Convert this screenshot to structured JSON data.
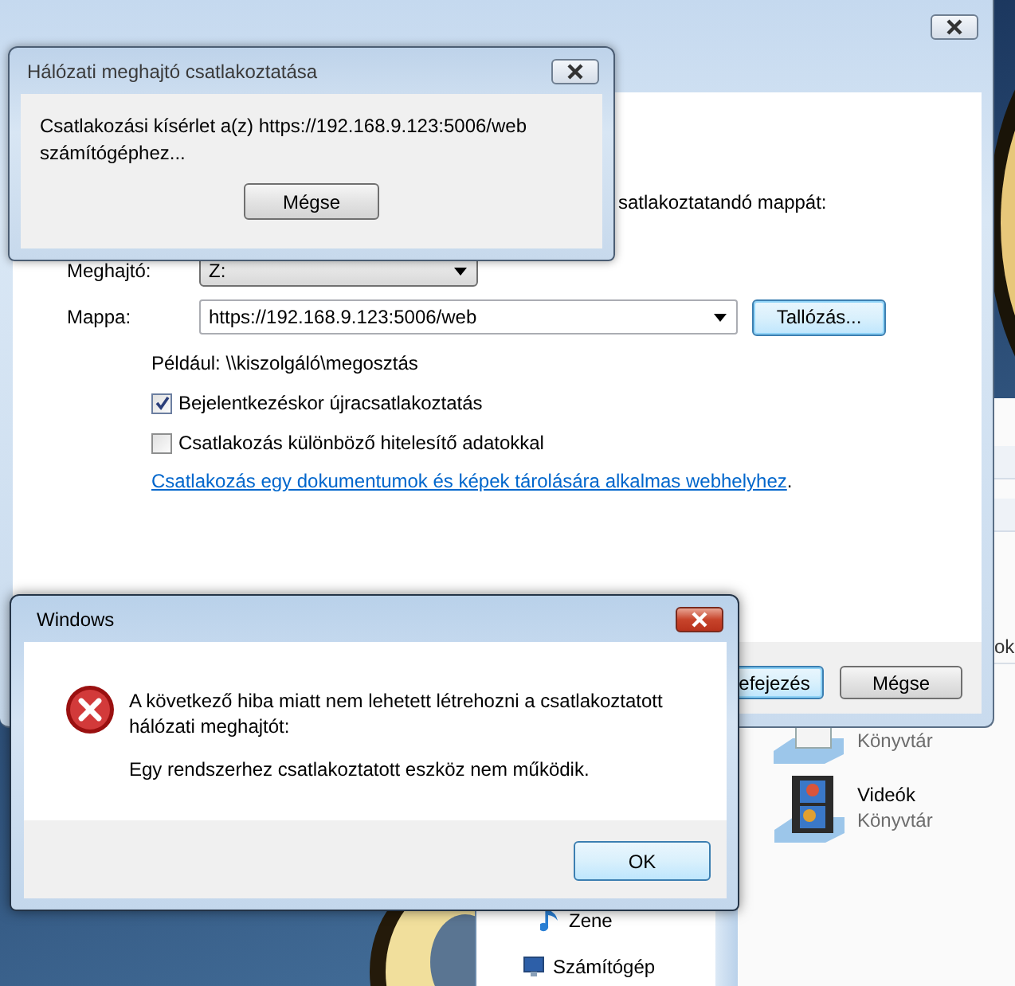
{
  "explorer": {
    "header_fragment": "ok",
    "library_items": [
      {
        "kind": "documents",
        "caption": "Könyvtár"
      },
      {
        "kind": "video",
        "title": "Videók",
        "caption": "Könyvtár"
      }
    ],
    "nav": {
      "libraries": [
        {
          "label": "Zene"
        }
      ],
      "computer": {
        "label": "Számítógép"
      }
    }
  },
  "map_drive_dialog": {
    "instruction": "satlakoztatandó mappát:",
    "drive_label": "Meghajtó:",
    "drive_value": "Z:",
    "folder_label": "Mappa:",
    "folder_value": "https://192.168.9.123:5006/web",
    "browse_button": {
      "label": "Tallózás...",
      "focused": true
    },
    "example": "Például: \\\\kiszolgáló\\megosztás",
    "options": [
      {
        "label": "Bejelentkezéskor újracsatlakoztatás",
        "checked": true
      },
      {
        "label": "Csatlakozás különböző hitelesítő adatokkal",
        "checked": false
      }
    ],
    "link": "Csatlakozás egy dokumentumok és képek tárolására alkalmas webhelyhez",
    "link_suffix": ".",
    "buttons": [
      {
        "label": "efejezés",
        "focused": true
      },
      {
        "label": "Mégse",
        "focused": false
      }
    ]
  },
  "progress_dialog": {
    "title": "Hálózati meghajtó csatlakoztatása",
    "message": "Csatlakozási kísérlet a(z) https://192.168.9.123:5006/web számítógéphez...",
    "button": "Mégse"
  },
  "error_dialog": {
    "title": "Windows",
    "message": "A következő hiba miatt nem lehetett létrehozni a csatlakoztatott hálózati meghajtót:",
    "detail": "Egy rendszerhez csatlakoztatott eszköz nem működik.",
    "button": "OK"
  }
}
